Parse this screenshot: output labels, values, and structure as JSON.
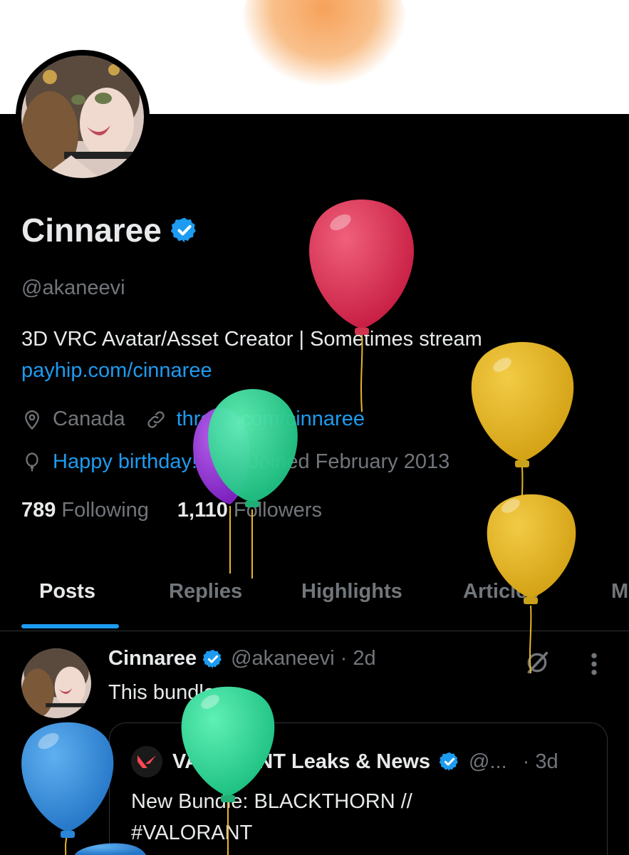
{
  "profile": {
    "display_name": "Cinnaree",
    "handle": "@akaneevi",
    "bio_line": "3D VRC Avatar/Asset Creator | Sometimes stream",
    "bio_link": "payhip.com/cinnaree",
    "location": "Canada",
    "website": "throne.com/cinnaree",
    "birthday": "Happy birthday!",
    "joined": "Joined February 2013",
    "following_count": "789",
    "following_label": "Following",
    "followers_count": "1,110",
    "followers_label": "Followers"
  },
  "tabs": [
    "Posts",
    "Replies",
    "Highlights",
    "Articles",
    "M"
  ],
  "active_tab": "Posts",
  "post": {
    "author": "Cinnaree",
    "handle": "@akaneevi",
    "time": "· 2d",
    "text": "This bundle...",
    "quote": {
      "author": "VALORANT Leaks & News",
      "handle": "@...",
      "time": "· 3d",
      "text_line1": "New Bundle: BLACKTHORN //",
      "text_line2": "#VALORANT"
    }
  },
  "colors": {
    "accent": "#1d9bf0",
    "muted": "#71767b",
    "text": "#e7e9ea",
    "background": "#000000",
    "balloon_red": "#e0405e",
    "balloon_yellow": "#e6b528",
    "balloon_green": "#3ddc9a",
    "balloon_purple": "#9b3fd4",
    "balloon_blue": "#3a93e0"
  },
  "icons": [
    "verified-badge-icon",
    "location-pin-icon",
    "link-icon",
    "balloon-icon",
    "calendar-icon",
    "grok-icon",
    "more-icon",
    "valorant-logo"
  ]
}
